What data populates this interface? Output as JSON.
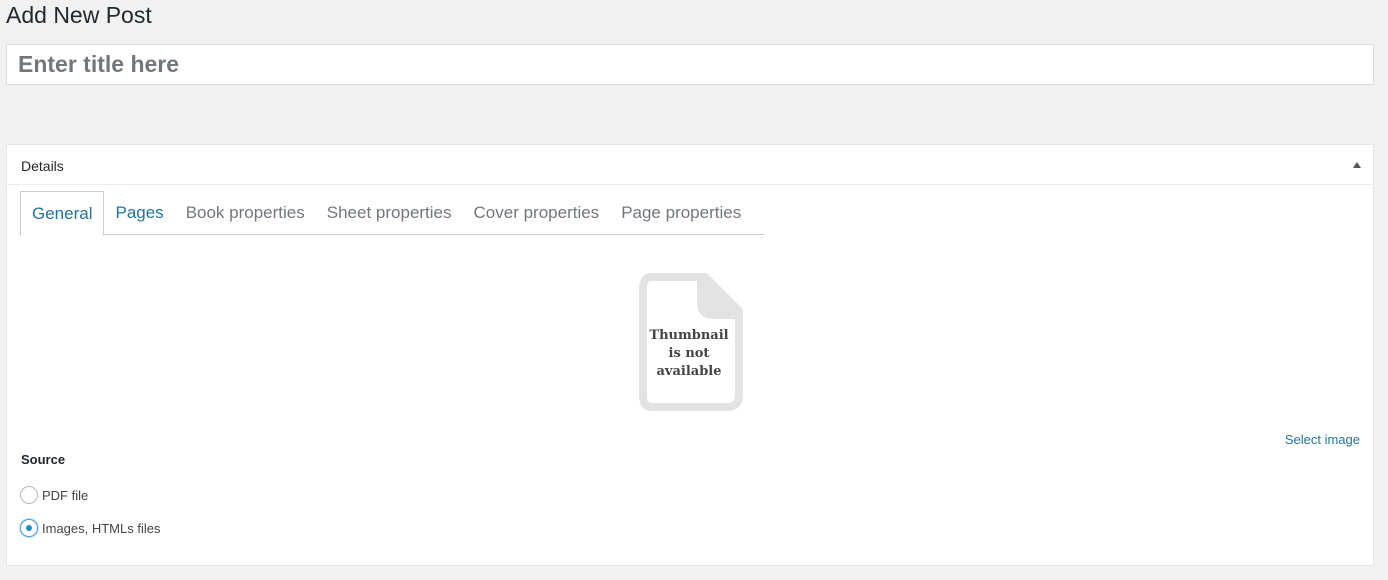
{
  "page": {
    "title": "Add New Post"
  },
  "title_field": {
    "placeholder": "Enter title here",
    "value": ""
  },
  "details": {
    "heading": "Details",
    "tabs": [
      {
        "label": "General"
      },
      {
        "label": "Pages"
      },
      {
        "label": "Book properties"
      },
      {
        "label": "Sheet properties"
      },
      {
        "label": "Cover properties"
      },
      {
        "label": "Page properties"
      }
    ],
    "thumbnail": {
      "line1": "Thumbnail",
      "line2": "is not",
      "line3": "available"
    },
    "select_image": "Select image",
    "source": {
      "label": "Source",
      "options": [
        {
          "label": "PDF file",
          "checked": false
        },
        {
          "label": "Images, HTMLs files",
          "checked": true
        }
      ]
    }
  },
  "colors": {
    "link": "#21759b",
    "background": "#f1f1f1",
    "radio_checked": "#1e8cbe"
  }
}
